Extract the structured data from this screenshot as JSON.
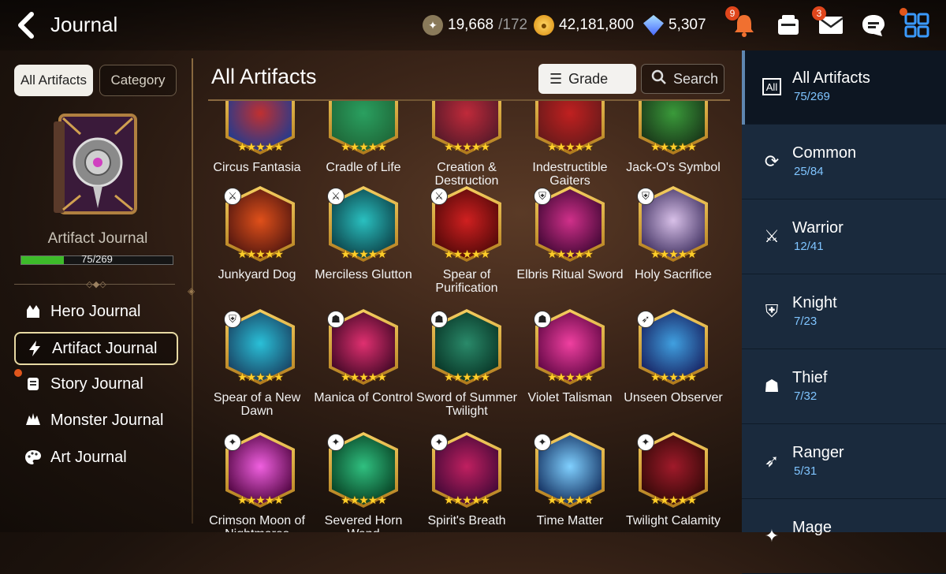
{
  "header": {
    "title": "Journal"
  },
  "currencies": [
    {
      "icon": "stamina-icon",
      "value": "19,668",
      "sub": "/172"
    },
    {
      "icon": "gold-icon",
      "value": "42,181,800",
      "sub": ""
    },
    {
      "icon": "crystal-icon",
      "value": "5,307",
      "sub": ""
    }
  ],
  "top_icons": {
    "notifications_badge": "9",
    "mail_badge": "3"
  },
  "left": {
    "seg_all": "All Artifacts",
    "seg_category": "Category",
    "journal_label": "Artifact Journal",
    "progress_text": "75/269",
    "progress_fraction": 0.279,
    "nav": [
      {
        "label": "Hero Journal",
        "icon": "hero-icon"
      },
      {
        "label": "Artifact Journal",
        "icon": "lightning-icon"
      },
      {
        "label": "Story Journal",
        "icon": "scroll-icon"
      },
      {
        "label": "Monster Journal",
        "icon": "monster-icon"
      },
      {
        "label": "Art Journal",
        "icon": "palette-icon"
      }
    ]
  },
  "main": {
    "title": "All Artifacts",
    "grade_label": "Grade",
    "search_label": "Search"
  },
  "artifacts": [
    {
      "name": "Circus Fantasia",
      "class_icon": "",
      "colors": [
        "#2a3a8a",
        "#c03030"
      ]
    },
    {
      "name": "Cradle of Life",
      "class_icon": "",
      "colors": [
        "#1f6a3a",
        "#2aa060"
      ]
    },
    {
      "name": "Creation & Destruction",
      "class_icon": "",
      "colors": [
        "#5a1a2a",
        "#c02a3a"
      ]
    },
    {
      "name": "Indestructible Gaiters",
      "class_icon": "",
      "colors": [
        "#6a1a1a",
        "#c02020"
      ]
    },
    {
      "name": "Jack-O's Symbol",
      "class_icon": "",
      "colors": [
        "#1a3a1a",
        "#3a9a3a"
      ]
    },
    {
      "name": "Junkyard Dog",
      "class_icon": "warrior",
      "colors": [
        "#5a1a10",
        "#e0501a"
      ]
    },
    {
      "name": "Merciless Glutton",
      "class_icon": "warrior",
      "colors": [
        "#0e4a50",
        "#2ac0c0"
      ]
    },
    {
      "name": "Spear of Purification",
      "class_icon": "warrior",
      "colors": [
        "#5a0a0a",
        "#d02020"
      ]
    },
    {
      "name": "Elbris Ritual Sword",
      "class_icon": "knight",
      "colors": [
        "#4a0a3a",
        "#d0308a"
      ]
    },
    {
      "name": "Holy Sacrifice",
      "class_icon": "knight",
      "colors": [
        "#4a3a6a",
        "#d8c0e8"
      ]
    },
    {
      "name": "Spear of a New Dawn",
      "class_icon": "knight",
      "colors": [
        "#1a4a6a",
        "#2ac0d8"
      ]
    },
    {
      "name": "Manica of Control",
      "class_icon": "thief",
      "colors": [
        "#4a0a2a",
        "#e03070"
      ]
    },
    {
      "name": "Sword of Summer Twilight",
      "class_icon": "thief",
      "colors": [
        "#0a3a2a",
        "#2a8a6a"
      ]
    },
    {
      "name": "Violet Talisman",
      "class_icon": "thief",
      "colors": [
        "#6a0a4a",
        "#f040a0"
      ]
    },
    {
      "name": "Unseen Observer",
      "class_icon": "ranger",
      "colors": [
        "#1a2a6a",
        "#40a0e0"
      ]
    },
    {
      "name": "Crimson Moon of Nightmares",
      "class_icon": "mage",
      "colors": [
        "#5a0a4a",
        "#f060e0"
      ]
    },
    {
      "name": "Severed Horn Wand",
      "class_icon": "mage",
      "colors": [
        "#0a4a2a",
        "#30c080"
      ]
    },
    {
      "name": "Spirit's Breath",
      "class_icon": "mage",
      "colors": [
        "#4a0a3a",
        "#c02060"
      ]
    },
    {
      "name": "Time Matter",
      "class_icon": "mage",
      "colors": [
        "#1a3a6a",
        "#80d0ff"
      ]
    },
    {
      "name": "Twilight Calamity",
      "class_icon": "mage",
      "colors": [
        "#3a0a0a",
        "#a01a2a"
      ]
    }
  ],
  "star_text": "★★★★★",
  "class_glyphs": {
    "warrior": "⚔",
    "knight": "⛨",
    "thief": "☗",
    "ranger": "➶",
    "mage": "✦"
  },
  "categories": [
    {
      "name": "All Artifacts",
      "count": "75/269",
      "icon": "all-icon"
    },
    {
      "name": "Common",
      "count": "25/84",
      "icon": "common-icon"
    },
    {
      "name": "Warrior",
      "count": "12/41",
      "icon": "warrior-icon"
    },
    {
      "name": "Knight",
      "count": "7/23",
      "icon": "knight-icon"
    },
    {
      "name": "Thief",
      "count": "7/32",
      "icon": "thief-icon"
    },
    {
      "name": "Ranger",
      "count": "5/31",
      "icon": "ranger-icon"
    },
    {
      "name": "Mage",
      "count": "",
      "icon": "mage-icon"
    }
  ],
  "all_icon_text": "All"
}
